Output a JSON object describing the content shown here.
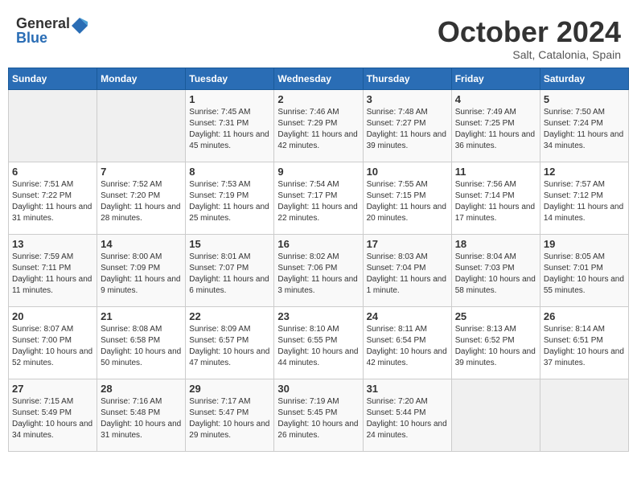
{
  "header": {
    "logo_general": "General",
    "logo_blue": "Blue",
    "month_title": "October 2024",
    "subtitle": "Salt, Catalonia, Spain"
  },
  "days_of_week": [
    "Sunday",
    "Monday",
    "Tuesday",
    "Wednesday",
    "Thursday",
    "Friday",
    "Saturday"
  ],
  "weeks": [
    [
      {
        "day": "",
        "info": ""
      },
      {
        "day": "",
        "info": ""
      },
      {
        "day": "1",
        "info": "Sunrise: 7:45 AM\nSunset: 7:31 PM\nDaylight: 11 hours and 45 minutes."
      },
      {
        "day": "2",
        "info": "Sunrise: 7:46 AM\nSunset: 7:29 PM\nDaylight: 11 hours and 42 minutes."
      },
      {
        "day": "3",
        "info": "Sunrise: 7:48 AM\nSunset: 7:27 PM\nDaylight: 11 hours and 39 minutes."
      },
      {
        "day": "4",
        "info": "Sunrise: 7:49 AM\nSunset: 7:25 PM\nDaylight: 11 hours and 36 minutes."
      },
      {
        "day": "5",
        "info": "Sunrise: 7:50 AM\nSunset: 7:24 PM\nDaylight: 11 hours and 34 minutes."
      }
    ],
    [
      {
        "day": "6",
        "info": "Sunrise: 7:51 AM\nSunset: 7:22 PM\nDaylight: 11 hours and 31 minutes."
      },
      {
        "day": "7",
        "info": "Sunrise: 7:52 AM\nSunset: 7:20 PM\nDaylight: 11 hours and 28 minutes."
      },
      {
        "day": "8",
        "info": "Sunrise: 7:53 AM\nSunset: 7:19 PM\nDaylight: 11 hours and 25 minutes."
      },
      {
        "day": "9",
        "info": "Sunrise: 7:54 AM\nSunset: 7:17 PM\nDaylight: 11 hours and 22 minutes."
      },
      {
        "day": "10",
        "info": "Sunrise: 7:55 AM\nSunset: 7:15 PM\nDaylight: 11 hours and 20 minutes."
      },
      {
        "day": "11",
        "info": "Sunrise: 7:56 AM\nSunset: 7:14 PM\nDaylight: 11 hours and 17 minutes."
      },
      {
        "day": "12",
        "info": "Sunrise: 7:57 AM\nSunset: 7:12 PM\nDaylight: 11 hours and 14 minutes."
      }
    ],
    [
      {
        "day": "13",
        "info": "Sunrise: 7:59 AM\nSunset: 7:11 PM\nDaylight: 11 hours and 11 minutes."
      },
      {
        "day": "14",
        "info": "Sunrise: 8:00 AM\nSunset: 7:09 PM\nDaylight: 11 hours and 9 minutes."
      },
      {
        "day": "15",
        "info": "Sunrise: 8:01 AM\nSunset: 7:07 PM\nDaylight: 11 hours and 6 minutes."
      },
      {
        "day": "16",
        "info": "Sunrise: 8:02 AM\nSunset: 7:06 PM\nDaylight: 11 hours and 3 minutes."
      },
      {
        "day": "17",
        "info": "Sunrise: 8:03 AM\nSunset: 7:04 PM\nDaylight: 11 hours and 1 minute."
      },
      {
        "day": "18",
        "info": "Sunrise: 8:04 AM\nSunset: 7:03 PM\nDaylight: 10 hours and 58 minutes."
      },
      {
        "day": "19",
        "info": "Sunrise: 8:05 AM\nSunset: 7:01 PM\nDaylight: 10 hours and 55 minutes."
      }
    ],
    [
      {
        "day": "20",
        "info": "Sunrise: 8:07 AM\nSunset: 7:00 PM\nDaylight: 10 hours and 52 minutes."
      },
      {
        "day": "21",
        "info": "Sunrise: 8:08 AM\nSunset: 6:58 PM\nDaylight: 10 hours and 50 minutes."
      },
      {
        "day": "22",
        "info": "Sunrise: 8:09 AM\nSunset: 6:57 PM\nDaylight: 10 hours and 47 minutes."
      },
      {
        "day": "23",
        "info": "Sunrise: 8:10 AM\nSunset: 6:55 PM\nDaylight: 10 hours and 44 minutes."
      },
      {
        "day": "24",
        "info": "Sunrise: 8:11 AM\nSunset: 6:54 PM\nDaylight: 10 hours and 42 minutes."
      },
      {
        "day": "25",
        "info": "Sunrise: 8:13 AM\nSunset: 6:52 PM\nDaylight: 10 hours and 39 minutes."
      },
      {
        "day": "26",
        "info": "Sunrise: 8:14 AM\nSunset: 6:51 PM\nDaylight: 10 hours and 37 minutes."
      }
    ],
    [
      {
        "day": "27",
        "info": "Sunrise: 7:15 AM\nSunset: 5:49 PM\nDaylight: 10 hours and 34 minutes."
      },
      {
        "day": "28",
        "info": "Sunrise: 7:16 AM\nSunset: 5:48 PM\nDaylight: 10 hours and 31 minutes."
      },
      {
        "day": "29",
        "info": "Sunrise: 7:17 AM\nSunset: 5:47 PM\nDaylight: 10 hours and 29 minutes."
      },
      {
        "day": "30",
        "info": "Sunrise: 7:19 AM\nSunset: 5:45 PM\nDaylight: 10 hours and 26 minutes."
      },
      {
        "day": "31",
        "info": "Sunrise: 7:20 AM\nSunset: 5:44 PM\nDaylight: 10 hours and 24 minutes."
      },
      {
        "day": "",
        "info": ""
      },
      {
        "day": "",
        "info": ""
      }
    ]
  ]
}
